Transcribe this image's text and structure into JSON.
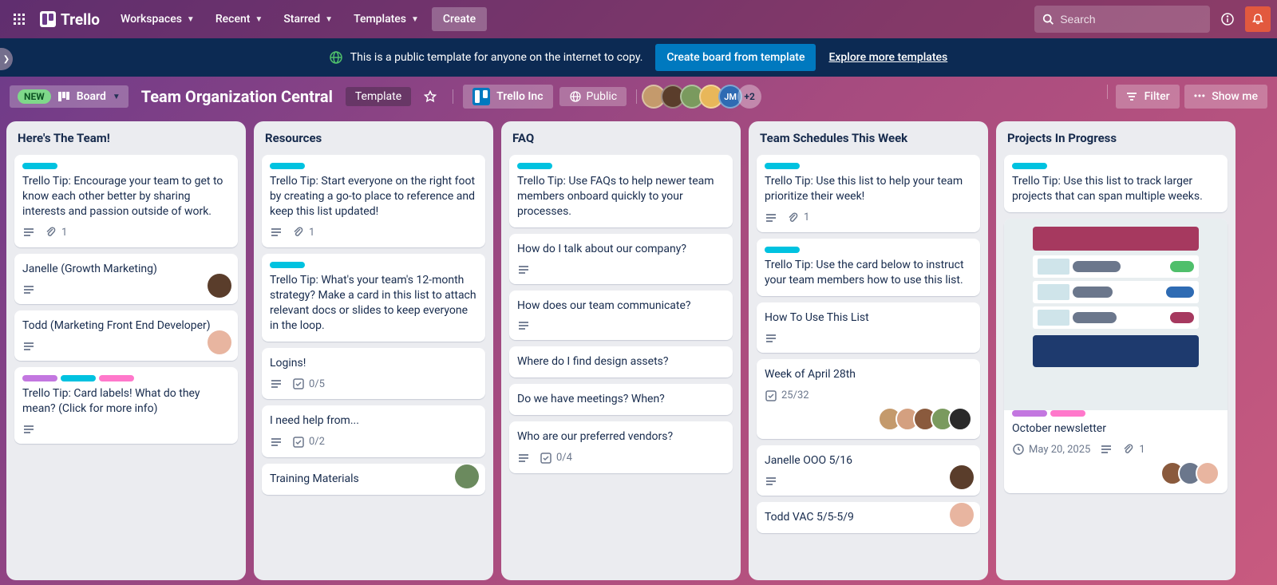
{
  "nav": {
    "logo_text": "Trello",
    "menu": [
      "Workspaces",
      "Recent",
      "Starred",
      "Templates"
    ],
    "create": "Create",
    "search_placeholder": "Search"
  },
  "banner": {
    "message": "This is a public template for anyone on the internet to copy.",
    "create_btn": "Create board from template",
    "explore": "Explore more templates"
  },
  "board_header": {
    "new_badge": "NEW",
    "board_btn": "Board",
    "title": "Team Organization Central",
    "template_chip": "Template",
    "workspace": "Trello Inc",
    "visibility": "Public",
    "avatars_extra": "+2",
    "filter": "Filter",
    "show_menu": "Show me"
  },
  "avatar_colors": [
    "#c49a6c",
    "#5a3d2b",
    "#7a9a5e",
    "#e8b75a",
    "#2e6bb3"
  ],
  "lists": [
    {
      "title": "Here's The Team!",
      "cards": [
        {
          "labels": [
            "#00c2e0"
          ],
          "title": "Trello Tip: Encourage your team to get to know each other better by sharing interests and passion outside of work.",
          "badges": {
            "desc": true,
            "attach": "1"
          }
        },
        {
          "title": "Janelle (Growth Marketing)",
          "badges": {
            "desc": true
          },
          "avatar": "#5a3d2b"
        },
        {
          "title": "Todd (Marketing Front End Developer)",
          "badges": {
            "desc": true
          },
          "avatar": "#e8b5a0"
        },
        {
          "labels": [
            "#c377e0",
            "#00c2e0",
            "#ff78cb"
          ],
          "title": "Trello Tip: Card labels! What do they mean? (Click for more info)",
          "badges": {
            "desc": true
          }
        }
      ]
    },
    {
      "title": "Resources",
      "cards": [
        {
          "labels": [
            "#00c2e0"
          ],
          "title": "Trello Tip: Start everyone on the right foot by creating a go-to place to reference and keep this list updated!",
          "badges": {
            "desc": true,
            "attach": "1"
          }
        },
        {
          "labels": [
            "#00c2e0"
          ],
          "title": "Trello Tip: What's your team's 12-month strategy? Make a card in this list to attach relevant docs or slides to keep everyone in the loop."
        },
        {
          "title": "Logins!",
          "badges": {
            "desc": true,
            "check": "0/5"
          }
        },
        {
          "title": "I need help from...",
          "badges": {
            "desc": true,
            "check": "0/2"
          }
        },
        {
          "title": "Training Materials",
          "avatar": "#6b8a5e"
        }
      ]
    },
    {
      "title": "FAQ",
      "cards": [
        {
          "labels": [
            "#00c2e0"
          ],
          "title": "Trello Tip: Use FAQs to help newer team members onboard quickly to your processes."
        },
        {
          "title": "How do I talk about our company?",
          "badges": {
            "desc": true
          }
        },
        {
          "title": "How does our team communicate?",
          "badges": {
            "desc": true
          }
        },
        {
          "title": "Where do I find design assets?"
        },
        {
          "title": "Do we have meetings? When?"
        },
        {
          "title": "Who are our preferred vendors?",
          "badges": {
            "desc": true,
            "check": "0/4"
          }
        }
      ]
    },
    {
      "title": "Team Schedules This Week",
      "cards": [
        {
          "labels": [
            "#00c2e0"
          ],
          "title": "Trello Tip: Use this list to help your team prioritize their week!",
          "badges": {
            "desc": true,
            "attach": "1"
          }
        },
        {
          "labels": [
            "#00c2e0"
          ],
          "title": "Trello Tip: Use the card below to instruct your team members how to use this list."
        },
        {
          "title": "How To Use This List",
          "badges": {
            "desc": true
          }
        },
        {
          "title": "Week of April 28th",
          "badges": {
            "check": "25/32"
          },
          "avatars": [
            "#c49a6c",
            "#d4a080",
            "#8a5a3d",
            "#7a9a5e",
            "#2a2a2a"
          ]
        },
        {
          "title": "Janelle OOO 5/16",
          "badges": {
            "desc": true
          },
          "avatar": "#5a3d2b"
        },
        {
          "title": "Todd VAC 5/5-5/9",
          "avatar": "#e8b5a0"
        }
      ]
    },
    {
      "title": "Projects In Progress",
      "cards": [
        {
          "labels": [
            "#00c2e0"
          ],
          "title": "Trello Tip: Use this list to track larger projects that can span multiple weeks."
        },
        {
          "cover": true,
          "labels": [
            "#c377e0",
            "#ff78cb"
          ],
          "title": "October newsletter",
          "badges": {
            "date": "May 20, 2025",
            "desc": true,
            "attach": "1"
          },
          "avatars": [
            "#8a5a3d",
            "#6b778c",
            "#e8b5a0"
          ]
        }
      ]
    }
  ]
}
